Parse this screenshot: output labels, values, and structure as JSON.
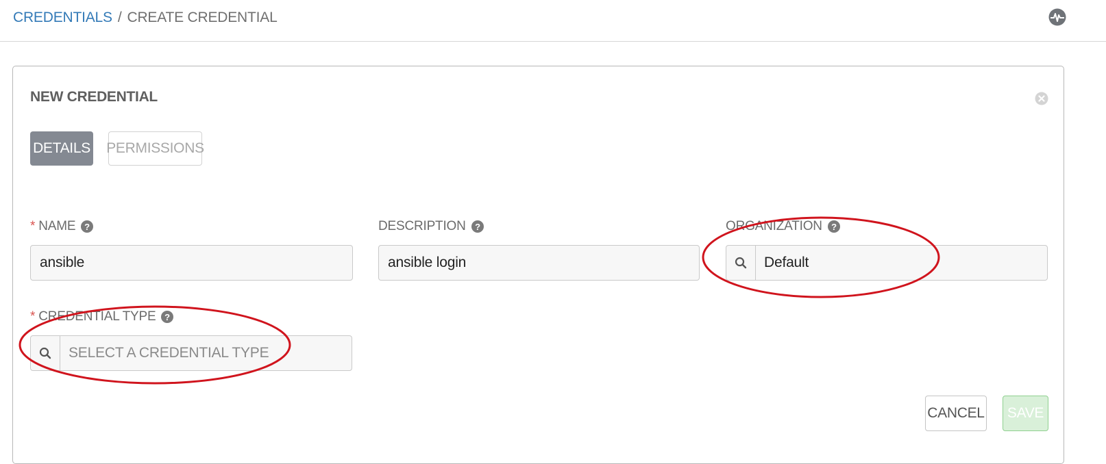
{
  "breadcrumb": {
    "parent": "CREDENTIALS",
    "separator": "/",
    "current": "CREATE CREDENTIAL"
  },
  "header_icons": {
    "activity": "activity-stream-icon"
  },
  "panel": {
    "title": "NEW CREDENTIAL",
    "close_icon": "close-icon",
    "tabs": [
      {
        "label": "DETAILS",
        "active": true
      },
      {
        "label": "PERMISSIONS",
        "active": false
      }
    ]
  },
  "form": {
    "required_marker": "*",
    "name": {
      "label": "NAME",
      "value": "ansible",
      "required": true
    },
    "description": {
      "label": "DESCRIPTION",
      "value": "ansible login",
      "required": false
    },
    "organization": {
      "label": "ORGANIZATION",
      "value": "Default",
      "required": false
    },
    "credential_type": {
      "label": "CREDENTIAL TYPE",
      "placeholder": "SELECT A CREDENTIAL TYPE",
      "required": true
    }
  },
  "actions": {
    "cancel_label": "CANCEL",
    "save_label": "SAVE"
  },
  "colors": {
    "link": "#337ab7",
    "active_tab": "#848992",
    "required": "#d9534f",
    "annotation": "#d0141d",
    "save_disabled": "#d9f0d9"
  }
}
